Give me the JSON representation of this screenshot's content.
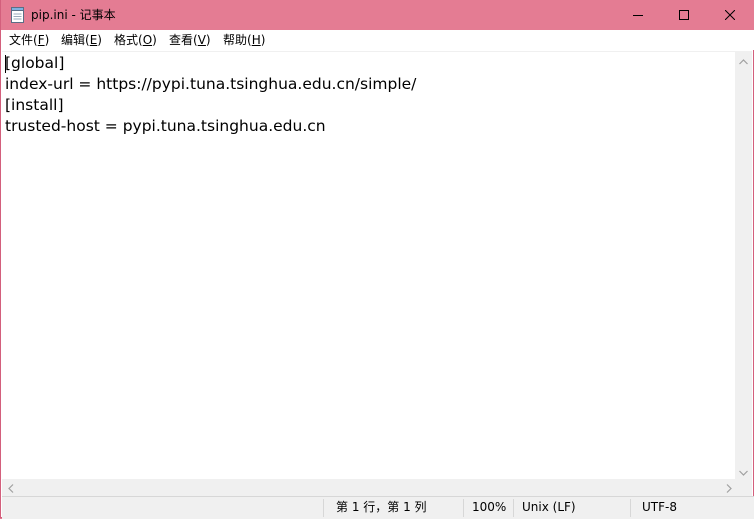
{
  "window": {
    "title": "pip.ini - 记事本",
    "title_bar_color": "#e47c93"
  },
  "caption_buttons": {
    "minimize": "minimize-icon",
    "maximize": "maximize-icon",
    "close": "close-icon"
  },
  "menu": {
    "file": {
      "label": "文件(",
      "key": "F",
      "end": ")"
    },
    "edit": {
      "label": "编辑(",
      "key": "E",
      "end": ")"
    },
    "format": {
      "label": "格式(",
      "key": "O",
      "end": ")"
    },
    "view": {
      "label": "查看(",
      "key": "V",
      "end": ")"
    },
    "help": {
      "label": "帮助(",
      "key": "H",
      "end": ")"
    }
  },
  "editor": {
    "lines": [
      "[global]",
      "index-url = https://pypi.tuna.tsinghua.edu.cn/simple/",
      "[install]",
      "trusted-host = pypi.tuna.tsinghua.edu.cn"
    ]
  },
  "status": {
    "position": "第 1 行，第 1 列",
    "zoom": "100%",
    "line_ending": "Unix (LF)",
    "encoding": "UTF-8"
  }
}
